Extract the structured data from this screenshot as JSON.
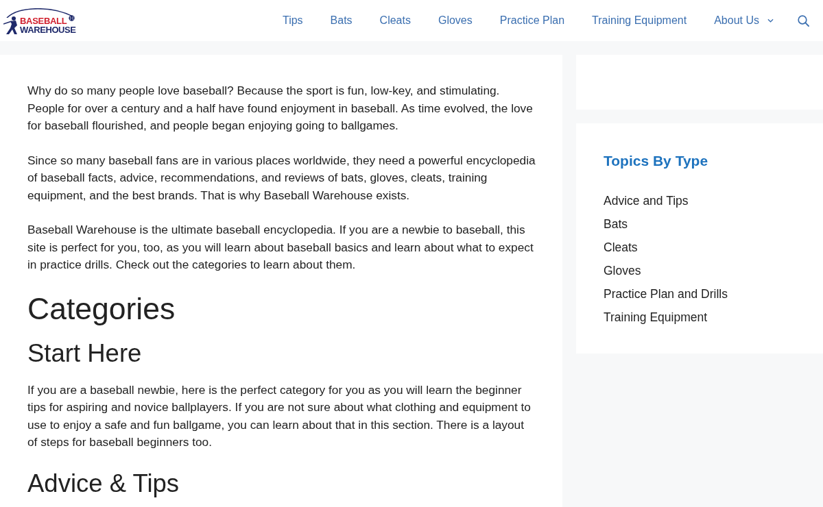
{
  "header": {
    "logo": {
      "line_1": "BASEBALL",
      "line_2": "WAREHOUSE"
    },
    "nav": [
      {
        "label": "Tips",
        "dropdown": false
      },
      {
        "label": "Bats",
        "dropdown": false
      },
      {
        "label": "Cleats",
        "dropdown": false
      },
      {
        "label": "Gloves",
        "dropdown": false
      },
      {
        "label": "Practice Plan",
        "dropdown": false
      },
      {
        "label": "Training Equipment",
        "dropdown": false
      },
      {
        "label": "About Us",
        "dropdown": true
      }
    ]
  },
  "content": [
    {
      "kind": "paragraph",
      "text": "Why do so many people love baseball? Because the sport is fun, low-key, and stimulating. People for over a century and a half have found enjoyment in baseball. As time evolved, the love for baseball flourished, and people began enjoying going to ballgames."
    },
    {
      "kind": "paragraph",
      "text": "Since so many baseball fans are in various places worldwide, they need a powerful encyclopedia of baseball facts, advice, recommendations, and reviews of bats, gloves, cleats, training equipment, and the best brands. That is why Baseball Warehouse exists."
    },
    {
      "kind": "paragraph",
      "text": "Baseball Warehouse is the ultimate baseball encyclopedia. If you are a newbie to baseball, this site is perfect for you, too, as you will learn about baseball basics and learn about what to expect in practice drills. Check out the categories to learn about them."
    },
    {
      "kind": "heading_1",
      "text": "Categories"
    },
    {
      "kind": "heading_2",
      "text": "Start Here"
    },
    {
      "kind": "paragraph",
      "text": "If you are a baseball newbie, here is the perfect category for you as you will learn the beginner tips for aspiring and novice ballplayers. If you are not sure about what clothing and equipment to use to enjoy a safe and fun ballgame, you can learn about that in this section. There is a layout of steps for baseball beginners too."
    },
    {
      "kind": "heading_2",
      "text": "Advice & Tips"
    }
  ],
  "sidebar": {
    "topics": {
      "title": "Topics By Type",
      "links": [
        "Advice and Tips",
        "Bats",
        "Cleats",
        "Gloves",
        "Practice Plan and Drills",
        "Training Equipment"
      ]
    }
  }
}
